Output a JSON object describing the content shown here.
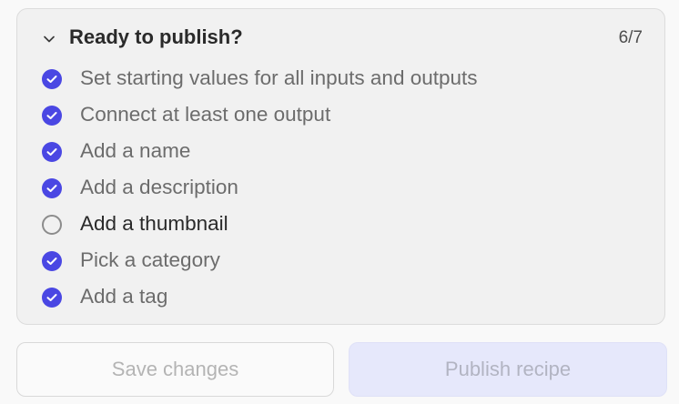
{
  "checklist": {
    "title": "Ready to publish?",
    "count": "6/7",
    "items": [
      {
        "label": "Set starting values for all inputs and outputs",
        "done": true
      },
      {
        "label": "Connect at least one output",
        "done": true
      },
      {
        "label": "Add a name",
        "done": true
      },
      {
        "label": "Add a description",
        "done": true
      },
      {
        "label": "Add a thumbnail",
        "done": false
      },
      {
        "label": "Pick a category",
        "done": true
      },
      {
        "label": "Add a tag",
        "done": true
      }
    ]
  },
  "actions": {
    "save_label": "Save changes",
    "publish_label": "Publish recipe"
  },
  "colors": {
    "accent": "#4a47e3",
    "panel_bg": "#f1f1f1",
    "publish_bg": "#e6e8fb"
  },
  "icons": {
    "collapse": "chevron-down-icon",
    "done": "check-circle-icon",
    "todo": "empty-circle-icon"
  }
}
